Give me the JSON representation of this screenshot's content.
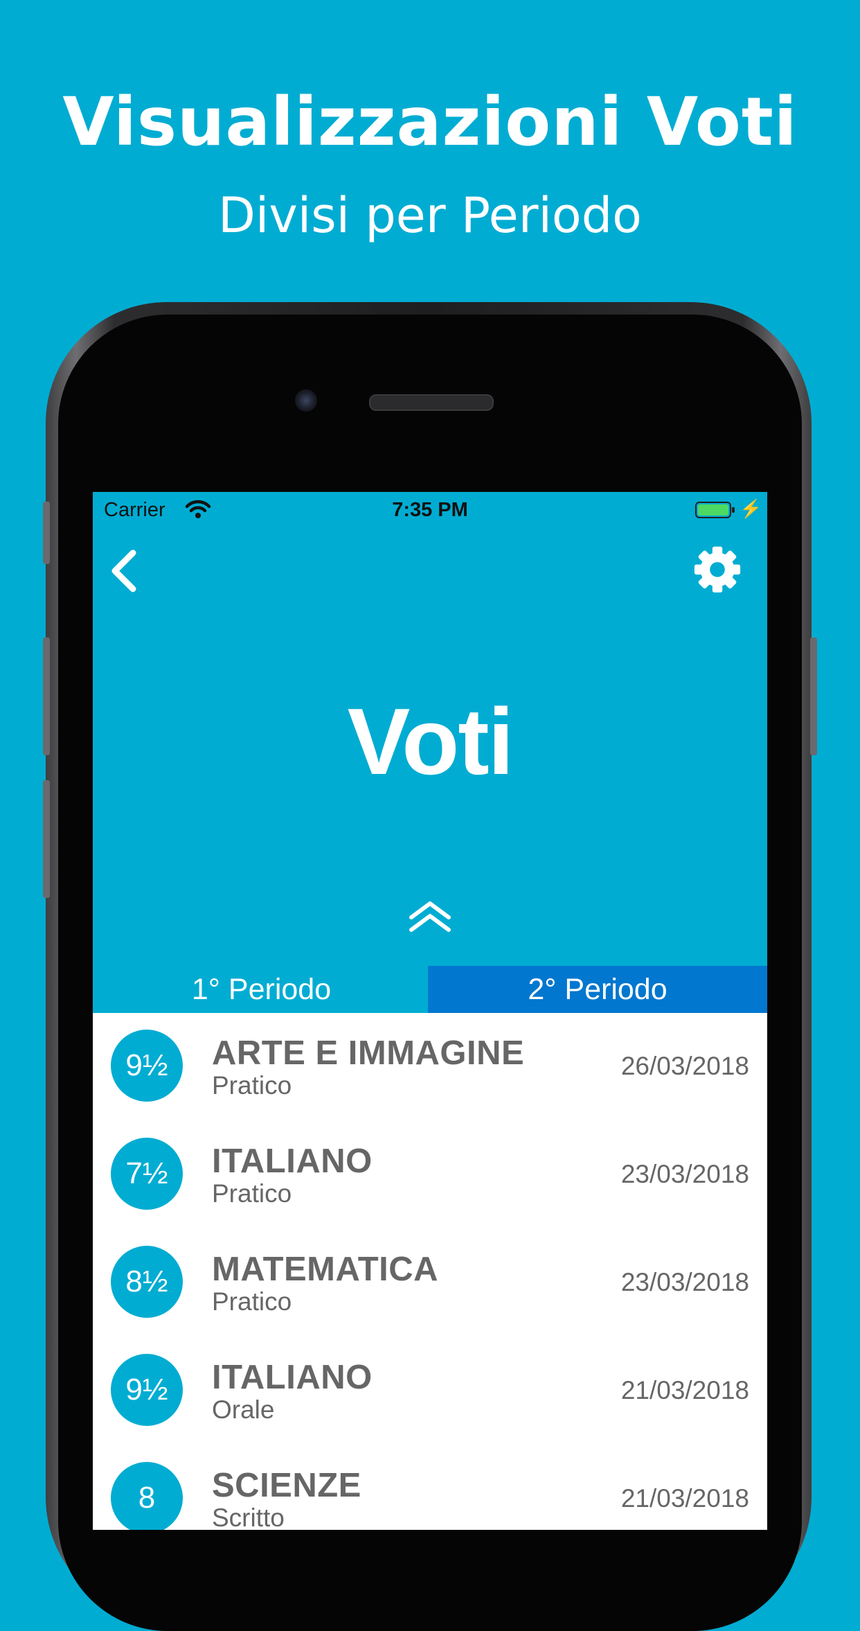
{
  "promo": {
    "title": "Visualizzazioni Voti",
    "subtitle": "Divisi per Periodo"
  },
  "status_bar": {
    "carrier": "Carrier",
    "time": "7:35 PM",
    "battery_color": "#4cd964"
  },
  "header": {
    "title": "Voti"
  },
  "tabs": [
    {
      "label": "1° Periodo",
      "selected": false
    },
    {
      "label": "2° Periodo",
      "selected": true
    }
  ],
  "grades": [
    {
      "grade": "9½",
      "subject": "ARTE E IMMAGINE",
      "type": "Pratico",
      "date": "26/03/2018"
    },
    {
      "grade": "7½",
      "subject": "ITALIANO",
      "type": "Pratico",
      "date": "23/03/2018"
    },
    {
      "grade": "8½",
      "subject": "MATEMATICA",
      "type": "Pratico",
      "date": "23/03/2018"
    },
    {
      "grade": "9½",
      "subject": "ITALIANO",
      "type": "Orale",
      "date": "21/03/2018"
    },
    {
      "grade": "8",
      "subject": "SCIENZE",
      "type": "Scritto",
      "date": "21/03/2018"
    }
  ],
  "colors": {
    "background": "#01acd2",
    "selected_tab": "#0177cf",
    "grade_circle": "#01acd2",
    "list_text": "#666666"
  },
  "icons": {
    "back": "chevron-left-icon",
    "settings": "gear-icon",
    "collapse": "double-chevron-up-icon",
    "wifi": "wifi-icon",
    "battery": "battery-icon",
    "charging": "bolt-icon"
  }
}
